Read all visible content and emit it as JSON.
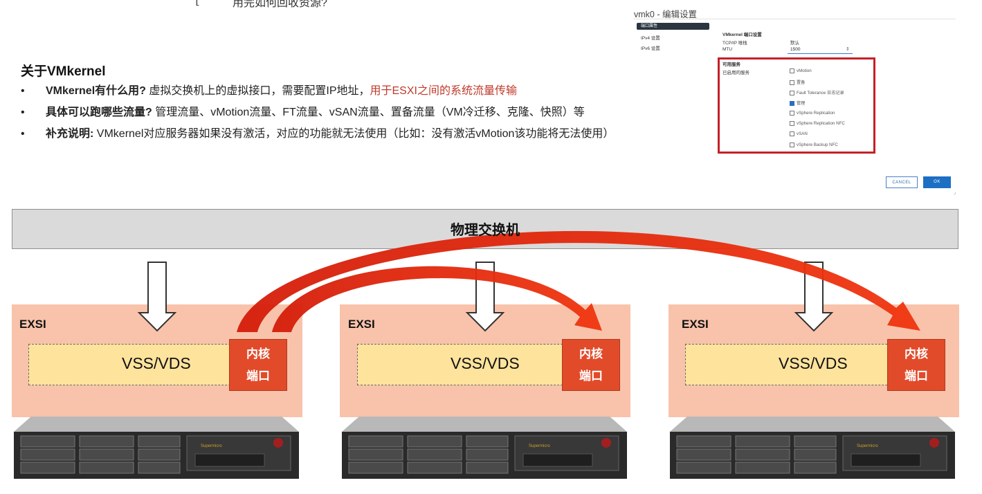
{
  "top_cutoff": {
    "text": "用完如何回收资源?"
  },
  "about": {
    "title": "关于VMkernel",
    "bullets": [
      {
        "dot": "•",
        "bold": "VMkernel有什么用?",
        "text": " 虚拟交换机上的虚拟接口，需要配置IP地址，",
        "red": "用于ESXI之间的系统流量传输"
      },
      {
        "dot": "•",
        "bold": "具体可以跑哪些流量?",
        "text": " 管理流量、vMotion流量、FT流量、vSAN流量、置备流量（VM冷迁移、克隆、快照）等",
        "red": ""
      },
      {
        "dot": "•",
        "bold": "补充说明:",
        "text": " VMkernel对应服务器如果没有激活，对应的功能就无法使用（比如：没有激活vMotion该功能将无法使用）",
        "red": ""
      }
    ]
  },
  "dialog": {
    "title": "vmk0 - 编辑设置",
    "sidebar": [
      "端口属性",
      "IPv4 设置",
      "IPv6 设置"
    ],
    "section_title": "VMkernel 端口设置",
    "tcpip_label": "TCP/IP 堆栈",
    "tcpip_value": "默认",
    "mtu_label": "MTU",
    "mtu_value": "1500",
    "services_title": "可用服务",
    "enabled_label": "已启用的服务",
    "services": [
      {
        "label": "vMotion",
        "checked": false
      },
      {
        "label": "置备",
        "checked": false
      },
      {
        "label": "Fault Tolerance 日志记录",
        "checked": false
      },
      {
        "label": "管理",
        "checked": true
      },
      {
        "label": "vSphere Replication",
        "checked": false
      },
      {
        "label": "vSphere Replication NFC",
        "checked": false
      },
      {
        "label": "vSAN",
        "checked": false
      },
      {
        "label": "vSphere Backup NFC",
        "checked": false
      }
    ],
    "cancel": "CANCEL",
    "ok": "OK"
  },
  "diagram": {
    "switch_label": "物理交换机",
    "hosts": [
      {
        "esxi": "EXSI",
        "vss": "VSS/VDS",
        "kport_line1": "内核",
        "kport_line2": "端口"
      },
      {
        "esxi": "EXSI",
        "vss": "VSS/VDS",
        "kport_line1": "内核",
        "kport_line2": "端口"
      },
      {
        "esxi": "EXSI",
        "vss": "VSS/VDS",
        "kport_line1": "内核",
        "kport_line2": "端口"
      }
    ],
    "server_brand": "Supermicro",
    "colors": {
      "arrow": "#e8210c",
      "kport": "#e14b2a",
      "esxi": "#f7b99b",
      "vss": "#fde39c",
      "switch": "#dadada"
    }
  }
}
